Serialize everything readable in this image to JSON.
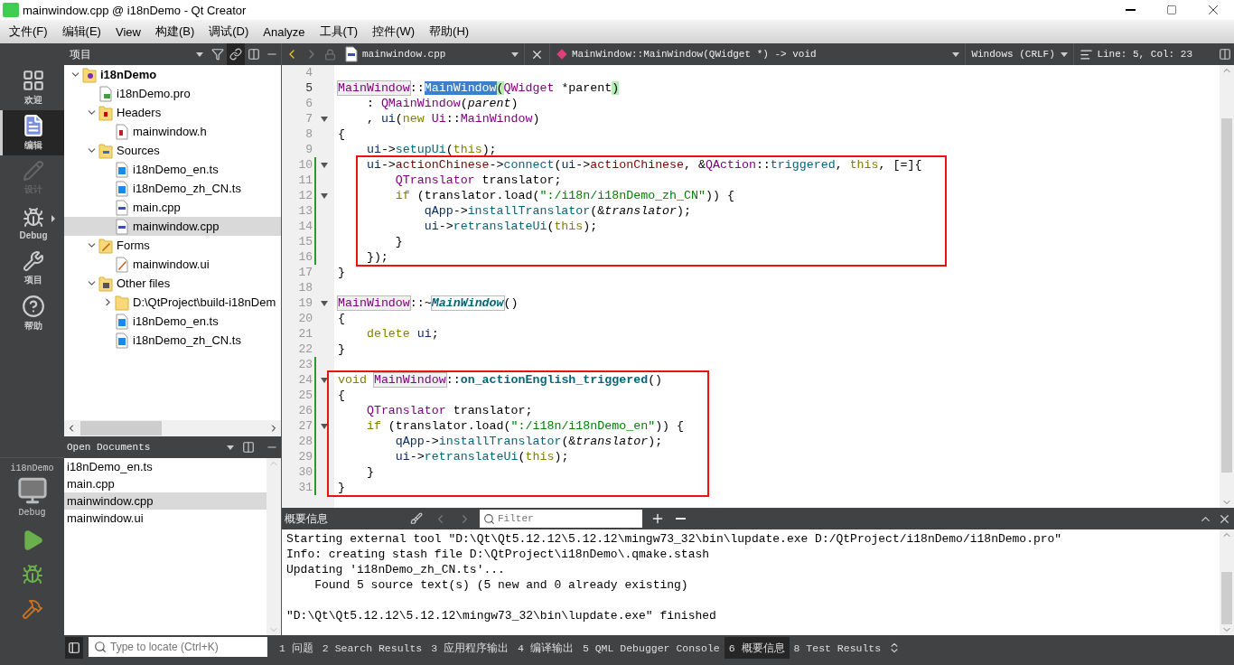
{
  "window": {
    "title": "mainwindow.cpp @ i18nDemo - Qt Creator"
  },
  "menu": [
    "文件(F)",
    "编辑(E)",
    "View",
    "构建(B)",
    "调试(D)",
    "Analyze",
    "工具(T)",
    "控件(W)",
    "帮助(H)"
  ],
  "modes": [
    {
      "label": "欢迎",
      "kind": "grid",
      "selected": false,
      "disabled": false,
      "has_menu": false
    },
    {
      "label": "编辑",
      "kind": "doc",
      "selected": true,
      "disabled": false,
      "has_menu": false
    },
    {
      "label": "设计",
      "kind": "pencil",
      "selected": false,
      "disabled": true,
      "has_menu": false
    },
    {
      "label": "Debug",
      "kind": "bug",
      "selected": false,
      "disabled": false,
      "has_menu": true
    },
    {
      "label": "项目",
      "kind": "wrench",
      "selected": false,
      "disabled": false,
      "has_menu": false
    },
    {
      "label": "帮助",
      "kind": "help",
      "selected": false,
      "disabled": false,
      "has_menu": false
    }
  ],
  "kit": {
    "project": "i18nDemo",
    "config": "Debug"
  },
  "run_buttons": [
    {
      "kind": "run"
    },
    {
      "kind": "debug-run"
    },
    {
      "kind": "build"
    }
  ],
  "sidebar": {
    "view": "项目",
    "tree": [
      {
        "label": "i18nDemo",
        "kind": "project",
        "bold": true,
        "selected": false,
        "expanded": true,
        "children": [
          {
            "label": "i18nDemo.pro",
            "kind": "pro",
            "selected": false
          },
          {
            "label": "Headers",
            "kind": "folder-h",
            "selected": false,
            "expanded": true,
            "children": [
              {
                "label": "mainwindow.h",
                "kind": "h",
                "selected": false
              }
            ]
          },
          {
            "label": "Sources",
            "kind": "folder-cpp",
            "selected": false,
            "expanded": true,
            "children": [
              {
                "label": "i18nDemo_en.ts",
                "kind": "ts",
                "selected": false
              },
              {
                "label": "i18nDemo_zh_CN.ts",
                "kind": "ts",
                "selected": false
              },
              {
                "label": "main.cpp",
                "kind": "cpp",
                "selected": false
              },
              {
                "label": "mainwindow.cpp",
                "kind": "cpp",
                "selected": true
              }
            ]
          },
          {
            "label": "Forms",
            "kind": "folder-ui",
            "selected": false,
            "expanded": true,
            "children": [
              {
                "label": "mainwindow.ui",
                "kind": "ui",
                "selected": false
              }
            ]
          },
          {
            "label": "Other files",
            "kind": "folder-other",
            "selected": false,
            "expanded": true,
            "children": [
              {
                "label": "D:\\QtProject\\build-i18nDem",
                "kind": "folder",
                "selected": false,
                "expanded": false
              },
              {
                "label": "i18nDemo_en.ts",
                "kind": "ts",
                "selected": false
              },
              {
                "label": "i18nDemo_zh_CN.ts",
                "kind": "ts",
                "selected": false
              }
            ]
          }
        ]
      }
    ],
    "open_documents": {
      "title": "Open Documents",
      "items": [
        {
          "label": "i18nDemo_en.ts",
          "selected": false
        },
        {
          "label": "main.cpp",
          "selected": false
        },
        {
          "label": "mainwindow.cpp",
          "selected": true
        },
        {
          "label": "mainwindow.ui",
          "selected": false
        }
      ]
    }
  },
  "editor": {
    "file": "mainwindow.cpp",
    "symbol": "MainWindow::MainWindow(QWidget *) -> void",
    "line_ending": "Windows (CRLF)",
    "position": "Line: 5, Col: 23",
    "blocks": [
      {
        "boxed": false,
        "lines": [
          {
            "n": "4",
            "fold": false,
            "changed": false,
            "current": false
          },
          {
            "n": "5",
            "fold": false,
            "changed": false,
            "current": true,
            "tokens": [
              {
                "text": "MainWindow",
                "kind": "ref"
              },
              {
                "text": "::",
                "kind": "p"
              },
              {
                "text": "MainWindow",
                "kind": "sel"
              },
              {
                "text": "(",
                "kind": "brace"
              },
              {
                "text": "QWidget",
                "kind": "type"
              },
              {
                "text": " *parent",
                "kind": "p"
              },
              {
                "text": ")",
                "kind": "brace"
              }
            ]
          },
          {
            "n": "6",
            "fold": false,
            "changed": false,
            "current": false,
            "tokens": [
              {
                "text": "    : ",
                "kind": "p"
              },
              {
                "text": "QMainWindow",
                "kind": "type"
              },
              {
                "text": "(",
                "kind": "p"
              },
              {
                "text": "parent",
                "kind": "param"
              },
              {
                "text": ")",
                "kind": "p"
              }
            ]
          },
          {
            "n": "7",
            "fold": true,
            "changed": false,
            "current": false,
            "tokens": [
              {
                "text": "    , ",
                "kind": "p"
              },
              {
                "text": "ui",
                "kind": "member"
              },
              {
                "text": "(",
                "kind": "p"
              },
              {
                "text": "new",
                "kind": "kw"
              },
              {
                "text": " Ui",
                "kind": "type"
              },
              {
                "text": "::",
                "kind": "p"
              },
              {
                "text": "MainWindow",
                "kind": "type"
              },
              {
                "text": ")",
                "kind": "p"
              }
            ]
          },
          {
            "n": "8",
            "fold": false,
            "changed": false,
            "current": false,
            "tokens": [
              {
                "text": "{",
                "kind": "p"
              }
            ]
          },
          {
            "n": "9",
            "fold": false,
            "changed": false,
            "current": false,
            "tokens": [
              {
                "text": "    ui",
                "kind": "member"
              },
              {
                "text": "->",
                "kind": "p"
              },
              {
                "text": "setupUi",
                "kind": "func"
              },
              {
                "text": "(",
                "kind": "p"
              },
              {
                "text": "this",
                "kind": "kw"
              },
              {
                "text": ");",
                "kind": "p"
              }
            ]
          }
        ]
      },
      {
        "boxed": true,
        "lines": [
          {
            "n": "10",
            "fold": true,
            "changed": true,
            "current": false,
            "tokens": [
              {
                "text": "    ui",
                "kind": "member"
              },
              {
                "text": "->",
                "kind": "p"
              },
              {
                "text": "actionChinese",
                "kind": "field"
              },
              {
                "text": "->",
                "kind": "p"
              },
              {
                "text": "connect",
                "kind": "func"
              },
              {
                "text": "(",
                "kind": "p"
              },
              {
                "text": "ui",
                "kind": "member"
              },
              {
                "text": "->",
                "kind": "p"
              },
              {
                "text": "actionChinese",
                "kind": "field"
              },
              {
                "text": ", &",
                "kind": "p"
              },
              {
                "text": "QAction",
                "kind": "type"
              },
              {
                "text": "::",
                "kind": "p"
              },
              {
                "text": "triggered",
                "kind": "func"
              },
              {
                "text": ", ",
                "kind": "p"
              },
              {
                "text": "this",
                "kind": "kw"
              },
              {
                "text": ", [=]{",
                "kind": "p"
              }
            ]
          },
          {
            "n": "11",
            "fold": false,
            "changed": true,
            "current": false,
            "tokens": [
              {
                "text": "        QTranslator",
                "kind": "type"
              },
              {
                "text": " translator;",
                "kind": "p"
              }
            ]
          },
          {
            "n": "12",
            "fold": true,
            "changed": true,
            "current": false,
            "tokens": [
              {
                "text": "        if",
                "kind": "kw"
              },
              {
                "text": " (translator.load(",
                "kind": "p"
              },
              {
                "text": "\":/i18n/i18nDemo_zh_CN\"",
                "kind": "str"
              },
              {
                "text": ")) {",
                "kind": "p"
              }
            ]
          },
          {
            "n": "13",
            "fold": false,
            "changed": true,
            "current": false,
            "tokens": [
              {
                "text": "            qApp",
                "kind": "member"
              },
              {
                "text": "->",
                "kind": "p"
              },
              {
                "text": "installTranslator",
                "kind": "func"
              },
              {
                "text": "(&",
                "kind": "p"
              },
              {
                "text": "translator",
                "kind": "param"
              },
              {
                "text": ");",
                "kind": "p"
              }
            ]
          },
          {
            "n": "14",
            "fold": false,
            "changed": true,
            "current": false,
            "tokens": [
              {
                "text": "            ui",
                "kind": "member"
              },
              {
                "text": "->",
                "kind": "p"
              },
              {
                "text": "retranslateUi",
                "kind": "func"
              },
              {
                "text": "(",
                "kind": "p"
              },
              {
                "text": "this",
                "kind": "kw"
              },
              {
                "text": ");",
                "kind": "p"
              }
            ]
          },
          {
            "n": "15",
            "fold": false,
            "changed": true,
            "current": false,
            "tokens": [
              {
                "text": "        }",
                "kind": "p"
              }
            ]
          },
          {
            "n": "16",
            "fold": false,
            "changed": true,
            "current": false,
            "tokens": [
              {
                "text": "    });",
                "kind": "p"
              }
            ]
          }
        ]
      },
      {
        "boxed": false,
        "lines": [
          {
            "n": "17",
            "fold": false,
            "changed": false,
            "current": false,
            "tokens": [
              {
                "text": "}",
                "kind": "p"
              }
            ]
          },
          {
            "n": "18",
            "fold": false,
            "changed": false,
            "current": false
          },
          {
            "n": "19",
            "fold": true,
            "changed": false,
            "current": false,
            "tokens": [
              {
                "text": "MainWindow",
                "kind": "ref"
              },
              {
                "text": "::~",
                "kind": "p"
              },
              {
                "text": "MainWindow",
                "kind": "dtor"
              },
              {
                "text": "()",
                "kind": "p"
              }
            ]
          },
          {
            "n": "20",
            "fold": false,
            "changed": false,
            "current": false,
            "tokens": [
              {
                "text": "{",
                "kind": "p"
              }
            ]
          },
          {
            "n": "21",
            "fold": false,
            "changed": false,
            "current": false,
            "tokens": [
              {
                "text": "    delete",
                "kind": "kw"
              },
              {
                "text": " ui",
                "kind": "member"
              },
              {
                "text": ";",
                "kind": "p"
              }
            ]
          },
          {
            "n": "22",
            "fold": false,
            "changed": false,
            "current": false,
            "tokens": [
              {
                "text": "}",
                "kind": "p"
              }
            ]
          },
          {
            "n": "23",
            "fold": false,
            "changed": true,
            "current": false
          }
        ]
      },
      {
        "boxed": true,
        "lines": [
          {
            "n": "24",
            "fold": true,
            "changed": true,
            "current": false,
            "tokens": [
              {
                "text": "void ",
                "kind": "kw"
              },
              {
                "text": "MainWindow",
                "kind": "ref"
              },
              {
                "text": "::",
                "kind": "p"
              },
              {
                "text": "on_actionEnglish_triggered",
                "kind": "fdef"
              },
              {
                "text": "()",
                "kind": "p"
              }
            ]
          },
          {
            "n": "25",
            "fold": false,
            "changed": true,
            "current": false,
            "tokens": [
              {
                "text": "{",
                "kind": "p"
              }
            ]
          },
          {
            "n": "26",
            "fold": false,
            "changed": true,
            "current": false,
            "tokens": [
              {
                "text": "    QTranslator",
                "kind": "type"
              },
              {
                "text": " translator;",
                "kind": "p"
              }
            ]
          },
          {
            "n": "27",
            "fold": true,
            "changed": true,
            "current": false,
            "tokens": [
              {
                "text": "    if",
                "kind": "kw"
              },
              {
                "text": " (translator.load(",
                "kind": "p"
              },
              {
                "text": "\":/i18n/i18nDemo_en\"",
                "kind": "str"
              },
              {
                "text": ")) {",
                "kind": "p"
              }
            ]
          },
          {
            "n": "28",
            "fold": false,
            "changed": true,
            "current": false,
            "tokens": [
              {
                "text": "        qApp",
                "kind": "member"
              },
              {
                "text": "->",
                "kind": "p"
              },
              {
                "text": "installTranslator",
                "kind": "func"
              },
              {
                "text": "(&",
                "kind": "p"
              },
              {
                "text": "translator",
                "kind": "param"
              },
              {
                "text": ");",
                "kind": "p"
              }
            ]
          },
          {
            "n": "29",
            "fold": false,
            "changed": true,
            "current": false,
            "tokens": [
              {
                "text": "        ui",
                "kind": "member"
              },
              {
                "text": "->",
                "kind": "p"
              },
              {
                "text": "retranslateUi",
                "kind": "func"
              },
              {
                "text": "(",
                "kind": "p"
              },
              {
                "text": "this",
                "kind": "kw"
              },
              {
                "text": ");",
                "kind": "p"
              }
            ]
          },
          {
            "n": "30",
            "fold": false,
            "changed": true,
            "current": false,
            "tokens": [
              {
                "text": "    }",
                "kind": "p"
              }
            ]
          },
          {
            "n": "31",
            "fold": false,
            "changed": true,
            "current": false,
            "tokens": [
              {
                "text": "}",
                "kind": "p"
              }
            ]
          }
        ]
      }
    ]
  },
  "output": {
    "title": "概要信息",
    "filter_placeholder": "Filter",
    "paragraphs": [
      [
        "Starting external tool \"D:\\Qt\\Qt5.12.12\\5.12.12\\mingw73_32\\bin\\lupdate.exe D:/QtProject/i18nDemo/i18nDemo.pro\"",
        "Info: creating stash file D:\\QtProject\\i18nDemo\\.qmake.stash",
        "Updating 'i18nDemo_zh_CN.ts'...",
        "    Found 5 source text(s) (5 new and 0 already existing)"
      ],
      [
        "\"D:\\Qt\\Qt5.12.12\\5.12.12\\mingw73_32\\bin\\lupdate.exe\" finished"
      ]
    ]
  },
  "bottom_bar": {
    "locate_placeholder": "Type to locate (Ctrl+K)",
    "tabs": [
      {
        "number": "1",
        "label": "问题",
        "selected": false
      },
      {
        "number": "2",
        "label": "Search Results",
        "selected": false
      },
      {
        "number": "3",
        "label": "应用程序输出",
        "selected": false
      },
      {
        "number": "4",
        "label": "编译输出",
        "selected": false
      },
      {
        "number": "5",
        "label": "QML Debugger Console",
        "selected": false
      },
      {
        "number": "6",
        "label": "概要信息",
        "selected": true
      },
      {
        "number": "8",
        "label": "Test Results",
        "selected": false
      }
    ]
  }
}
